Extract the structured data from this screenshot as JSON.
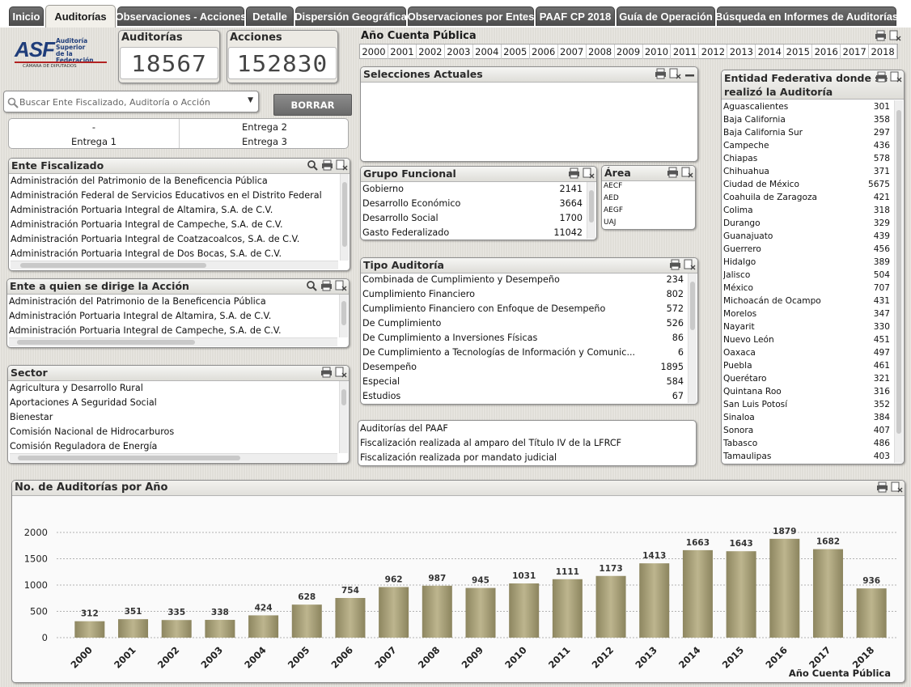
{
  "tabs": [
    {
      "label": "Inicio"
    },
    {
      "label": "Auditorías"
    },
    {
      "label": "Observaciones - Acciones"
    },
    {
      "label": "Detalle"
    },
    {
      "label": "Dispersión Geográfica"
    },
    {
      "label": "Observaciones por Entes"
    },
    {
      "label": "PAAF CP 2018"
    },
    {
      "label": "Guía de Operación"
    },
    {
      "label": "Búsqueda en Informes de Auditorías"
    }
  ],
  "logo": {
    "text": "ASF",
    "line1": "Auditoría",
    "line2": "Superior",
    "line3": "de la Federación",
    "sub": "CÁMARA DE DIPUTADOS"
  },
  "kpi": {
    "auditorias_label": "Auditorías",
    "auditorias_value": "18567",
    "acciones_label": "Acciones",
    "acciones_value": "152830"
  },
  "search": {
    "placeholder": "Buscar Ente Fiscalizado, Auditoría o Acción",
    "button": "BORRAR"
  },
  "entregas": [
    "-",
    "Entrega 2",
    "Entrega 1",
    "Entrega 3"
  ],
  "ente_fiscalizado": {
    "title": "Ente Fiscalizado",
    "items": [
      "Administración del Patrimonio de la Beneficencia Pública",
      "Administración Federal de Servicios Educativos en el Distrito Federal",
      "Administración Portuaria Integral de Altamira, S.A. de C.V.",
      "Administración Portuaria Integral de Campeche, S.A. de C.V.",
      "Administración Portuaria Integral de Coatzacoalcos, S.A. de C.V.",
      "Administración Portuaria Integral de Dos Bocas, S.A. de C.V."
    ]
  },
  "ente_accion": {
    "title": "Ente a quien se dirige la Acción",
    "items": [
      "Administración del Patrimonio de la Beneficencia Pública",
      "Administración Portuaria Integral de Altamira, S.A. de C.V.",
      "Administración Portuaria Integral de Campeche, S.A. de C.V."
    ]
  },
  "sector": {
    "title": "Sector",
    "items": [
      "Agricultura y Desarrollo Rural",
      "Aportaciones A Seguridad Social",
      "Bienestar",
      "Comisión Nacional de Hidrocarburos",
      "Comisión Reguladora de Energía"
    ]
  },
  "anio": {
    "title": "Año Cuenta Pública",
    "years": [
      "2000",
      "2001",
      "2002",
      "2003",
      "2004",
      "2005",
      "2006",
      "2007",
      "2008",
      "2009",
      "2010",
      "2011",
      "2012",
      "2013",
      "2014",
      "2015",
      "2016",
      "2017",
      "2018"
    ]
  },
  "selecciones": {
    "title": "Selecciones Actuales"
  },
  "grupo": {
    "title": "Grupo Funcional",
    "items": [
      {
        "name": "Gobierno",
        "value": "2141"
      },
      {
        "name": "Desarrollo Económico",
        "value": "3664"
      },
      {
        "name": "Desarrollo Social",
        "value": "1700"
      },
      {
        "name": "Gasto Federalizado",
        "value": "11042"
      }
    ]
  },
  "area": {
    "title": "Área",
    "items": [
      "AECF",
      "AED",
      "AEGF",
      "UAJ"
    ]
  },
  "tipo": {
    "title": "Tipo Auditoría",
    "items": [
      {
        "name": "Combinada de Cumplimiento y Desempeño",
        "value": "234"
      },
      {
        "name": "Cumplimiento Financiero",
        "value": "802"
      },
      {
        "name": "Cumplimiento Financiero con Enfoque de Desempeño",
        "value": "572"
      },
      {
        "name": "De Cumplimiento",
        "value": "526"
      },
      {
        "name": "De Cumplimiento a Inversiones Físicas",
        "value": "86"
      },
      {
        "name": "De Cumplimiento a Tecnologías de Información y Comunic...",
        "value": "6"
      },
      {
        "name": "Desempeño",
        "value": "1895"
      },
      {
        "name": "Especial",
        "value": "584"
      },
      {
        "name": "Estudios",
        "value": "67"
      }
    ]
  },
  "paaf": {
    "items": [
      "Auditorías del PAAF",
      "Fiscalización realizada al amparo del Título IV de la LFRCF",
      "Fiscalización realizada por mandato judicial"
    ]
  },
  "entidad": {
    "title": "Entidad Federativa donde se realizó la Auditoría",
    "title1": "Entidad Federativa donde se",
    "title2": "realizó la Auditoría",
    "items": [
      {
        "name": "Aguascalientes",
        "value": "301"
      },
      {
        "name": "Baja California",
        "value": "358"
      },
      {
        "name": "Baja California Sur",
        "value": "297"
      },
      {
        "name": "Campeche",
        "value": "436"
      },
      {
        "name": "Chiapas",
        "value": "578"
      },
      {
        "name": "Chihuahua",
        "value": "371"
      },
      {
        "name": "Ciudad de México",
        "value": "5675"
      },
      {
        "name": "Coahuila de Zaragoza",
        "value": "421"
      },
      {
        "name": "Colima",
        "value": "318"
      },
      {
        "name": "Durango",
        "value": "329"
      },
      {
        "name": "Guanajuato",
        "value": "439"
      },
      {
        "name": "Guerrero",
        "value": "456"
      },
      {
        "name": "Hidalgo",
        "value": "389"
      },
      {
        "name": "Jalisco",
        "value": "504"
      },
      {
        "name": "México",
        "value": "707"
      },
      {
        "name": "Michoacán de Ocampo",
        "value": "431"
      },
      {
        "name": "Morelos",
        "value": "347"
      },
      {
        "name": "Nayarit",
        "value": "330"
      },
      {
        "name": "Nuevo León",
        "value": "451"
      },
      {
        "name": "Oaxaca",
        "value": "497"
      },
      {
        "name": "Puebla",
        "value": "461"
      },
      {
        "name": "Querétaro",
        "value": "321"
      },
      {
        "name": "Quintana Roo",
        "value": "316"
      },
      {
        "name": "San Luis Potosí",
        "value": "352"
      },
      {
        "name": "Sinaloa",
        "value": "384"
      },
      {
        "name": "Sonora",
        "value": "407"
      },
      {
        "name": "Tabasco",
        "value": "486"
      },
      {
        "name": "Tamaulipas",
        "value": "403"
      }
    ]
  },
  "chart_panel": {
    "title": "No. de Auditorías por Año"
  },
  "chart_data": {
    "type": "bar",
    "title": "No. de Auditorías por Año",
    "xlabel": "Año Cuenta Pública",
    "ylabel": "",
    "categories": [
      "2000",
      "2001",
      "2002",
      "2003",
      "2004",
      "2005",
      "2006",
      "2007",
      "2008",
      "2009",
      "2010",
      "2011",
      "2012",
      "2013",
      "2014",
      "2015",
      "2016",
      "2017",
      "2018"
    ],
    "values": [
      312,
      351,
      335,
      338,
      424,
      628,
      754,
      962,
      987,
      945,
      1031,
      1111,
      1173,
      1413,
      1663,
      1643,
      1879,
      1682,
      936
    ],
    "yticks": [
      0,
      500,
      1000,
      1500,
      2000
    ],
    "ylim": [
      0,
      2000
    ],
    "grid": true,
    "bar_color": "#a8a07a"
  }
}
